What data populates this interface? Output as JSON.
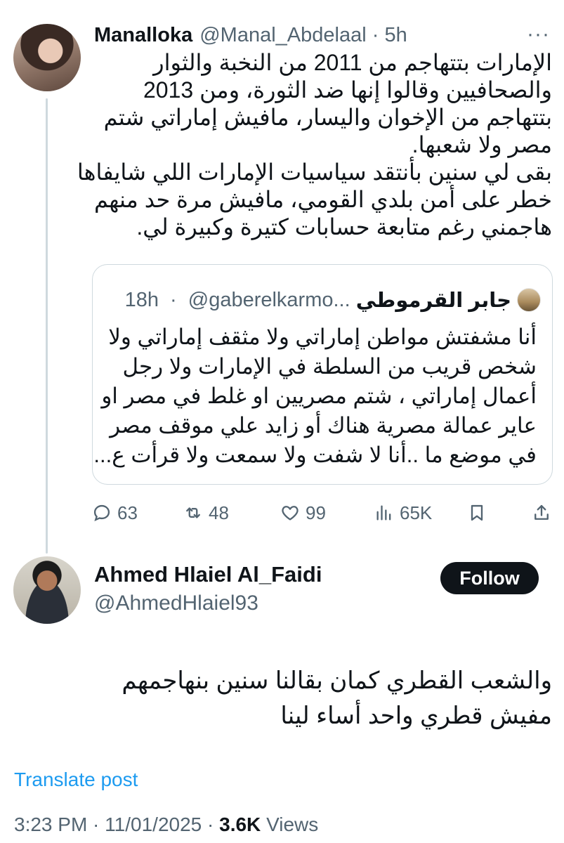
{
  "tweet1": {
    "author_name": "Manalloka",
    "handle": "@Manal_Abdelaal",
    "separator": " · ",
    "time": "5h",
    "lines": [
      "الإمارات بتتهاجم من 2011 من النخبة والثوار",
      "والصحافيين وقالوا إنها ضد الثورة، ومن 2013",
      "بتتهاجم من الإخوان واليسار، مافيش إماراتي شتم",
      "مصر ولا شعبها.",
      "بقى لي سنين بأنتقد سياسيات الإمارات اللي شايفاها",
      "خطر على أمن بلدي القومي، مافيش مرة حد منهم",
      "هاجمني رغم متابعة حسابات كتيرة وكبيرة لي."
    ]
  },
  "quote": {
    "author_name": "جابر القرموطي",
    "handle": "@gaberelkarmo...",
    "separator": " · ",
    "time": "18h",
    "lines": [
      "أنا مشفتش مواطن  إماراتي ولا مثقف إماراتي ولا",
      "شخص قريب من السلطة في الإمارات ولا رجل",
      "أعمال إماراتي ، شتم مصريين او غلط في مصر او",
      "عاير عمالة مصرية هناك أو زايد علي موقف مصر",
      "في موضع ما ..أنا لا شفت ولا سمعت ولا قرأت ع..."
    ]
  },
  "actions": {
    "replies": "63",
    "reposts": "48",
    "likes": "99",
    "views": "65K"
  },
  "tweet2": {
    "author_name": "Ahmed Hlaiel Al_Faidi",
    "handle": "@AhmedHlaiel93",
    "follow_label": "Follow",
    "lines": [
      "والشعب القطري كمان بقالنا سنين بنهاجمهم",
      "مفيش قطري واحد أساء لينا"
    ],
    "translate_label": "Translate post",
    "time": "3:23 PM",
    "date": "11/01/2025",
    "separator": " · ",
    "views_count": "3.6K",
    "views_label": "Views"
  },
  "colors": {
    "text": "#0f1419",
    "muted": "#536471",
    "link": "#1d9bf0",
    "border": "#cfd9de",
    "button_bg": "#0f1419"
  }
}
